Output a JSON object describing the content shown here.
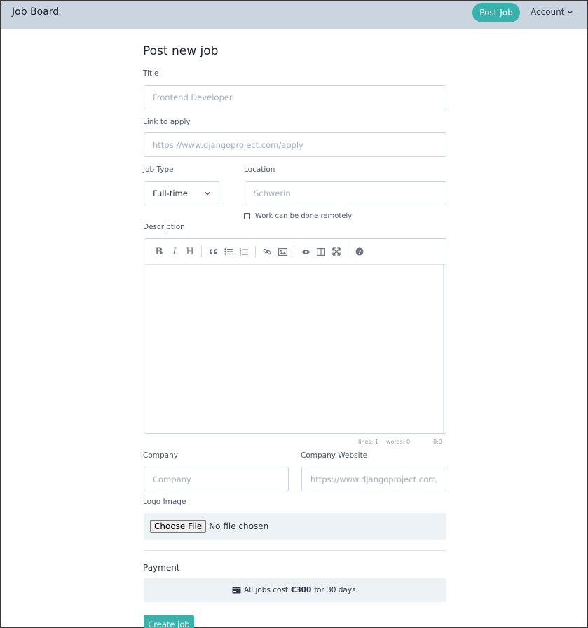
{
  "navbar": {
    "brand": "Job Board",
    "post_job": "Post Job",
    "account": "Account"
  },
  "form": {
    "heading": "Post new job",
    "title": {
      "label": "Title",
      "placeholder": "Frontend Developer"
    },
    "apply_link": {
      "label": "Link to apply",
      "placeholder": "https://www.djangoproject.com/apply"
    },
    "job_type": {
      "label": "Job Type",
      "value": "Full-time"
    },
    "location": {
      "label": "Location",
      "placeholder": "Schwerin"
    },
    "remote": {
      "label": "Work can be done remotely",
      "checked": false
    },
    "description": {
      "label": "Description",
      "toolbar": [
        "bold",
        "italic",
        "heading",
        "quote",
        "unordered-list",
        "ordered-list",
        "link",
        "image",
        "preview",
        "side-by-side",
        "fullscreen",
        "guide"
      ],
      "status": {
        "lines": "lines: 1",
        "words": "words: 0",
        "cursor": "0:0"
      }
    },
    "company": {
      "label": "Company",
      "placeholder": "Company"
    },
    "company_website": {
      "label": "Company Website",
      "placeholder": "https://www.djangoproject.com/"
    },
    "logo": {
      "label": "Logo Image",
      "button": "Choose File",
      "status": "No file chosen"
    },
    "payment": {
      "title": "Payment",
      "text_prefix": "All jobs cost",
      "price": "€300",
      "text_suffix": "for 30 days."
    },
    "submit": "Create job"
  },
  "colors": {
    "accent": "#38b2ac",
    "navbar_bg": "#cbd5e0",
    "panel_bg": "#edf2f7"
  }
}
